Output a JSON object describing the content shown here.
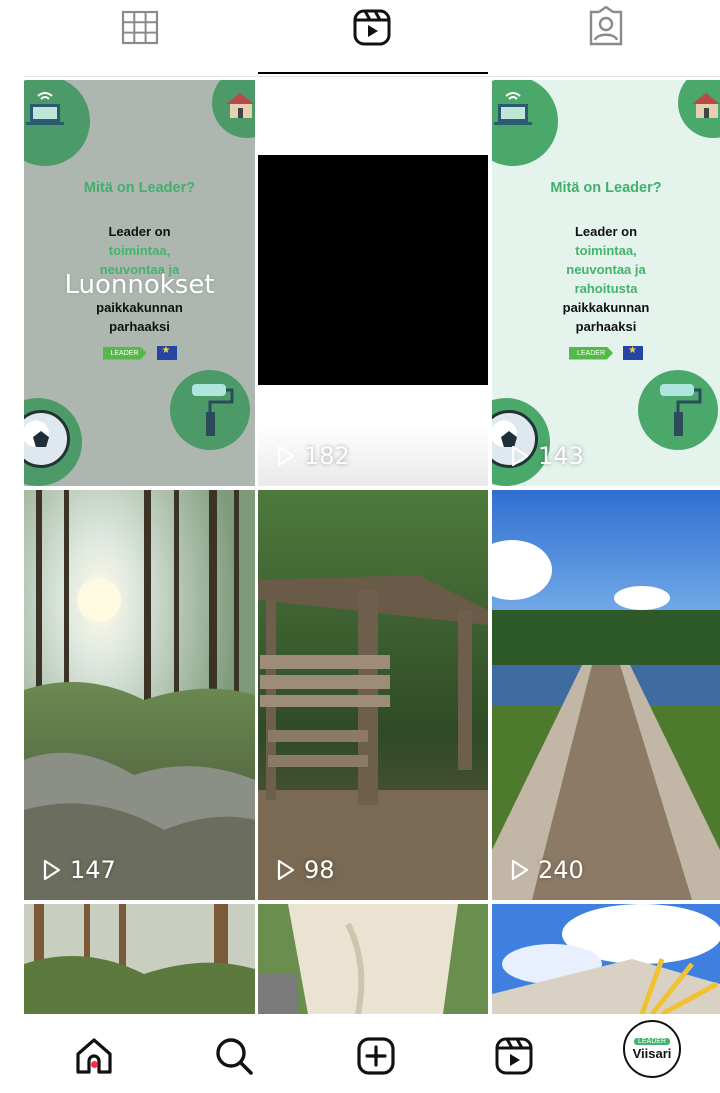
{
  "tabs": [
    {
      "name": "grid",
      "icon": "grid-icon"
    },
    {
      "name": "reels",
      "icon": "reels-icon",
      "active": true
    },
    {
      "name": "tagged",
      "icon": "tagged-person-icon"
    }
  ],
  "grid": {
    "tiles": [
      {
        "type": "leader-graphic",
        "overlay_label": "Luonnokset",
        "question": "Mitä on Leader?",
        "lines": [
          "Leader on",
          "toimintaa,",
          "neuvontaa ja",
          "rahoitusta",
          "paikkakunnan",
          "parhaaksi"
        ],
        "logo_text": "LEADER"
      },
      {
        "type": "video",
        "views": "182"
      },
      {
        "type": "leader-graphic",
        "question": "Mitä on Leader?",
        "lines": [
          "Leader on",
          "toimintaa,",
          "neuvontaa ja",
          "rahoitusta",
          "paikkakunnan",
          "parhaaksi"
        ],
        "logo_text": "LEADER",
        "views": "143"
      },
      {
        "type": "photo",
        "subject": "sunlit forest",
        "views": "147"
      },
      {
        "type": "photo",
        "subject": "trail signpost",
        "views": "98"
      },
      {
        "type": "photo",
        "subject": "lake pier",
        "views": "240"
      },
      {
        "type": "photo",
        "subject": "forest",
        "views": ""
      },
      {
        "type": "photo",
        "subject": "white sculpture",
        "views": ""
      },
      {
        "type": "photo",
        "subject": "pavilion roof",
        "views": ""
      }
    ]
  },
  "bottom_nav": {
    "items": [
      {
        "name": "home",
        "icon": "home-icon",
        "active": true
      },
      {
        "name": "search",
        "icon": "search-icon"
      },
      {
        "name": "create",
        "icon": "add-post-icon"
      },
      {
        "name": "reels",
        "icon": "reels-icon"
      },
      {
        "name": "profile",
        "icon": "avatar"
      }
    ],
    "avatar_badge": "LEADER",
    "avatar_name": "Viisari"
  },
  "colors": {
    "accent_green": "#44b36d",
    "notification": "#ff2b4a"
  }
}
